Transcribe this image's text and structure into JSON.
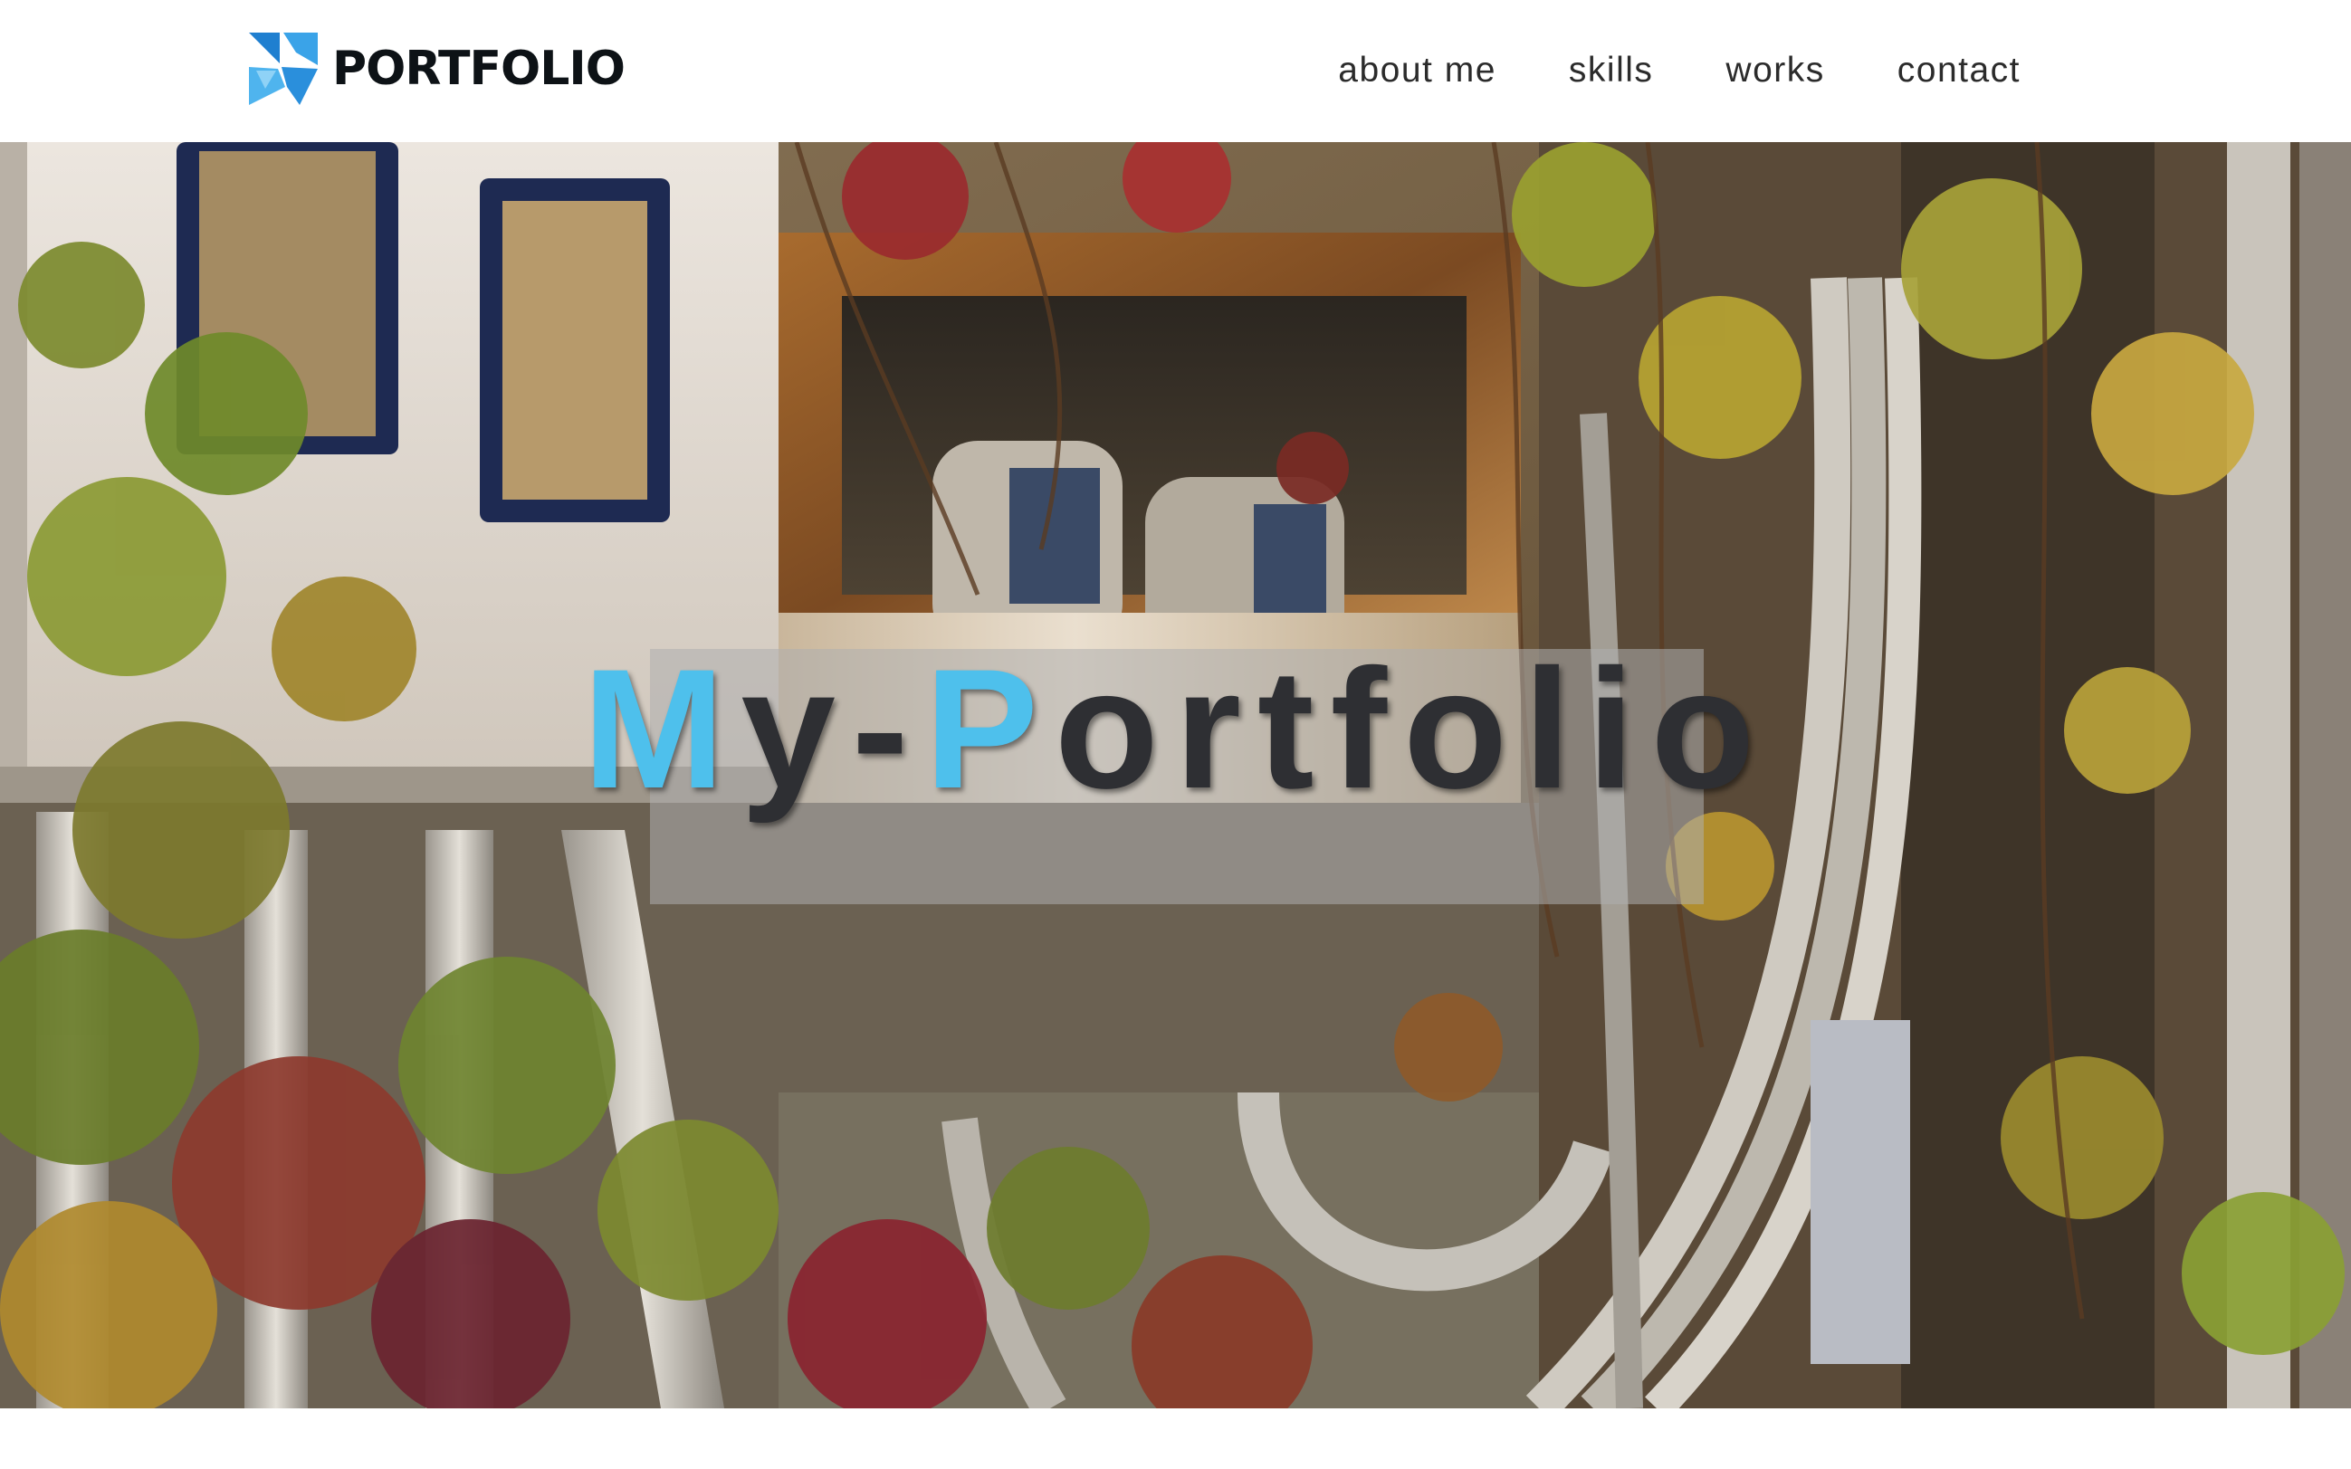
{
  "header": {
    "brand": "PORTFOLIO",
    "brand_icon": "portfolio-logo-icon",
    "nav": [
      {
        "label": "about me"
      },
      {
        "label": "skills"
      },
      {
        "label": "works"
      },
      {
        "label": "contact"
      }
    ]
  },
  "hero": {
    "title_parts": [
      "M",
      "y-",
      "P",
      "ortfolio"
    ],
    "accent_color": "#4ec0ec",
    "image": "photo of rusted utility box overgrown with vines and autumn leaves"
  },
  "colors": {
    "text_dark": "#2e2f33",
    "logo_blue": "#3a9fe0"
  }
}
